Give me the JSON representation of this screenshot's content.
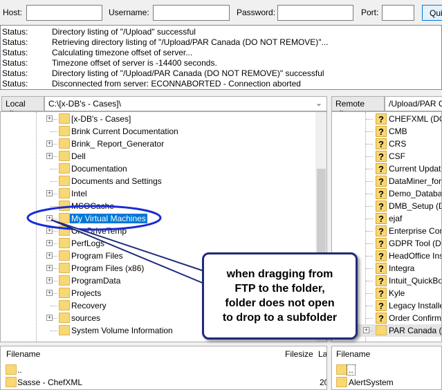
{
  "toolbar": {
    "host_label": "Host:",
    "username_label": "Username:",
    "password_label": "Password:",
    "port_label": "Port:",
    "quickconnect_label": "Qui"
  },
  "log": [
    {
      "k": "Status:",
      "v": "Directory listing of \"/Upload\" successful"
    },
    {
      "k": "Status:",
      "v": "Retrieving directory listing of \"/Upload/PAR Canada (DO NOT REMOVE)\"..."
    },
    {
      "k": "Status:",
      "v": "Calculating timezone offset of server..."
    },
    {
      "k": "Status:",
      "v": "Timezone offset of server is -14400 seconds."
    },
    {
      "k": "Status:",
      "v": "Directory listing of \"/Upload/PAR Canada (DO NOT REMOVE)\" successful"
    },
    {
      "k": "Status:",
      "v": "Disconnected from server: ECONNABORTED - Connection aborted"
    }
  ],
  "local": {
    "label": "Local site:",
    "path": "C:\\[x-DB's - Cases]\\",
    "tree": [
      {
        "name": "[x-DB's - Cases]",
        "plus": true
      },
      {
        "name": "Brink Current Documentation",
        "plus": false
      },
      {
        "name": "Brink_ Report_Generator",
        "plus": true
      },
      {
        "name": "Dell",
        "plus": true
      },
      {
        "name": "Documentation",
        "plus": false
      },
      {
        "name": "Documents and Settings",
        "plus": false
      },
      {
        "name": "Intel",
        "plus": true
      },
      {
        "name": "MSOCache",
        "plus": false
      },
      {
        "name": "My Virtual Machines",
        "plus": true,
        "selected": true
      },
      {
        "name": "OneDriveTemp",
        "plus": true
      },
      {
        "name": "PerfLogs",
        "plus": true
      },
      {
        "name": "Program Files",
        "plus": true
      },
      {
        "name": "Program Files (x86)",
        "plus": true
      },
      {
        "name": "ProgramData",
        "plus": true
      },
      {
        "name": "Projects",
        "plus": true
      },
      {
        "name": "Recovery",
        "plus": false
      },
      {
        "name": "sources",
        "plus": true
      },
      {
        "name": "System Volume Information",
        "plus": false
      }
    ],
    "list_headers": {
      "filename": "Filename",
      "filesize": "Filesize",
      "lastmod": "La"
    },
    "files": [
      {
        "name": "..",
        "size": "",
        "date": ""
      },
      {
        "name": "Sasse - ChefXML",
        "size": "",
        "date": "20"
      }
    ]
  },
  "remote": {
    "label": "Remote site:",
    "path": "/Upload/PAR C",
    "tree": [
      {
        "name": "CHEFXML (DO",
        "unknown": true
      },
      {
        "name": "CMB",
        "unknown": true
      },
      {
        "name": "CRS",
        "unknown": true
      },
      {
        "name": "CSF",
        "unknown": true
      },
      {
        "name": "Current Update",
        "unknown": true
      },
      {
        "name": "DataMiner_for_",
        "unknown": true
      },
      {
        "name": "Demo_Databas",
        "unknown": true
      },
      {
        "name": "DMB_Setup (Do",
        "unknown": true
      },
      {
        "name": "ejaf",
        "unknown": true
      },
      {
        "name": "Enterprise Com",
        "unknown": true
      },
      {
        "name": "GDPR Tool (Do",
        "unknown": true
      },
      {
        "name": "HeadOffice Ins",
        "unknown": true
      },
      {
        "name": "Integra",
        "unknown": true
      },
      {
        "name": "Intuit_QuickBo",
        "unknown": true
      },
      {
        "name": "Kyle",
        "unknown": true
      },
      {
        "name": "Legacy Installe",
        "unknown": true
      },
      {
        "name": "Order Confirm",
        "unknown": true
      },
      {
        "name": "PAR Canada (D",
        "unknown": false,
        "plus": true,
        "current": true
      }
    ],
    "list_headers": {
      "filename": "Filename"
    },
    "files": [
      {
        "name": ".."
      },
      {
        "name": "AlertSystem"
      }
    ]
  },
  "annotation": {
    "text": [
      "when dragging from",
      "FTP to the folder,",
      "folder does not open",
      "to drop to a subfolder"
    ],
    "color": "#1a2bd6",
    "box_border": "#1f2a7a"
  }
}
